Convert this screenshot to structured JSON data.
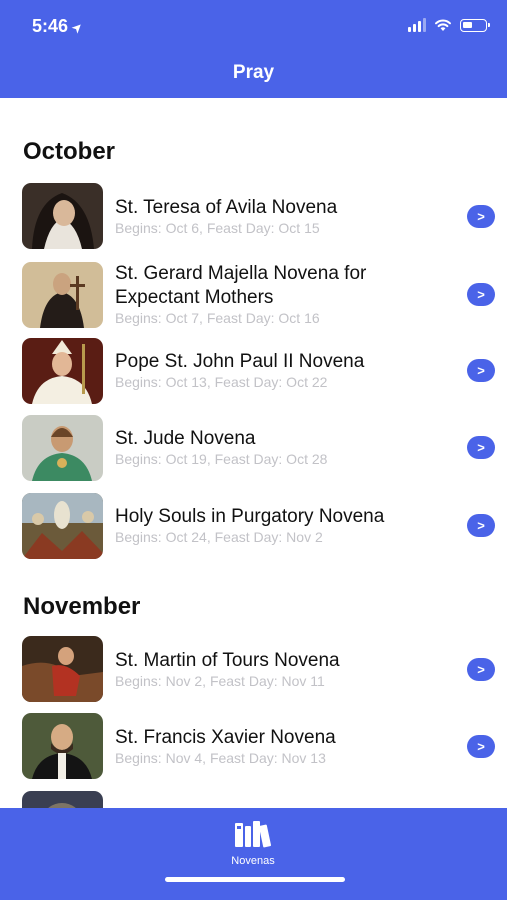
{
  "status_bar": {
    "time": "5:46"
  },
  "nav": {
    "title": "Pray"
  },
  "sections": [
    {
      "title": "October",
      "items": [
        {
          "title": "St. Teresa of Avila Novena",
          "subtitle": "Begins: Oct 6, Feast Day: Oct 15"
        },
        {
          "title": "St. Gerard Majella Novena for Expectant Mothers",
          "subtitle": "Begins: Oct 7, Feast Day: Oct 16"
        },
        {
          "title": "Pope St. John Paul II Novena",
          "subtitle": "Begins: Oct 13, Feast Day: Oct 22"
        },
        {
          "title": "St. Jude Novena",
          "subtitle": "Begins: Oct 19, Feast Day: Oct 28"
        },
        {
          "title": "Holy Souls in Purgatory Novena",
          "subtitle": "Begins: Oct 24, Feast Day: Nov 2"
        }
      ]
    },
    {
      "title": "November",
      "items": [
        {
          "title": "St. Martin of Tours Novena",
          "subtitle": "Begins: Nov 2, Feast Day: Nov 11"
        },
        {
          "title": "St. Francis Xavier Novena",
          "subtitle": "Begins: Nov 4, Feast Day: Nov 13"
        }
      ]
    }
  ],
  "chevron_glyph": ">",
  "tab_bar": {
    "novenas_label": "Novenas",
    "icon": "books-icon"
  },
  "colors": {
    "accent": "#4a63e8",
    "subtitle": "#c2c2c7"
  }
}
